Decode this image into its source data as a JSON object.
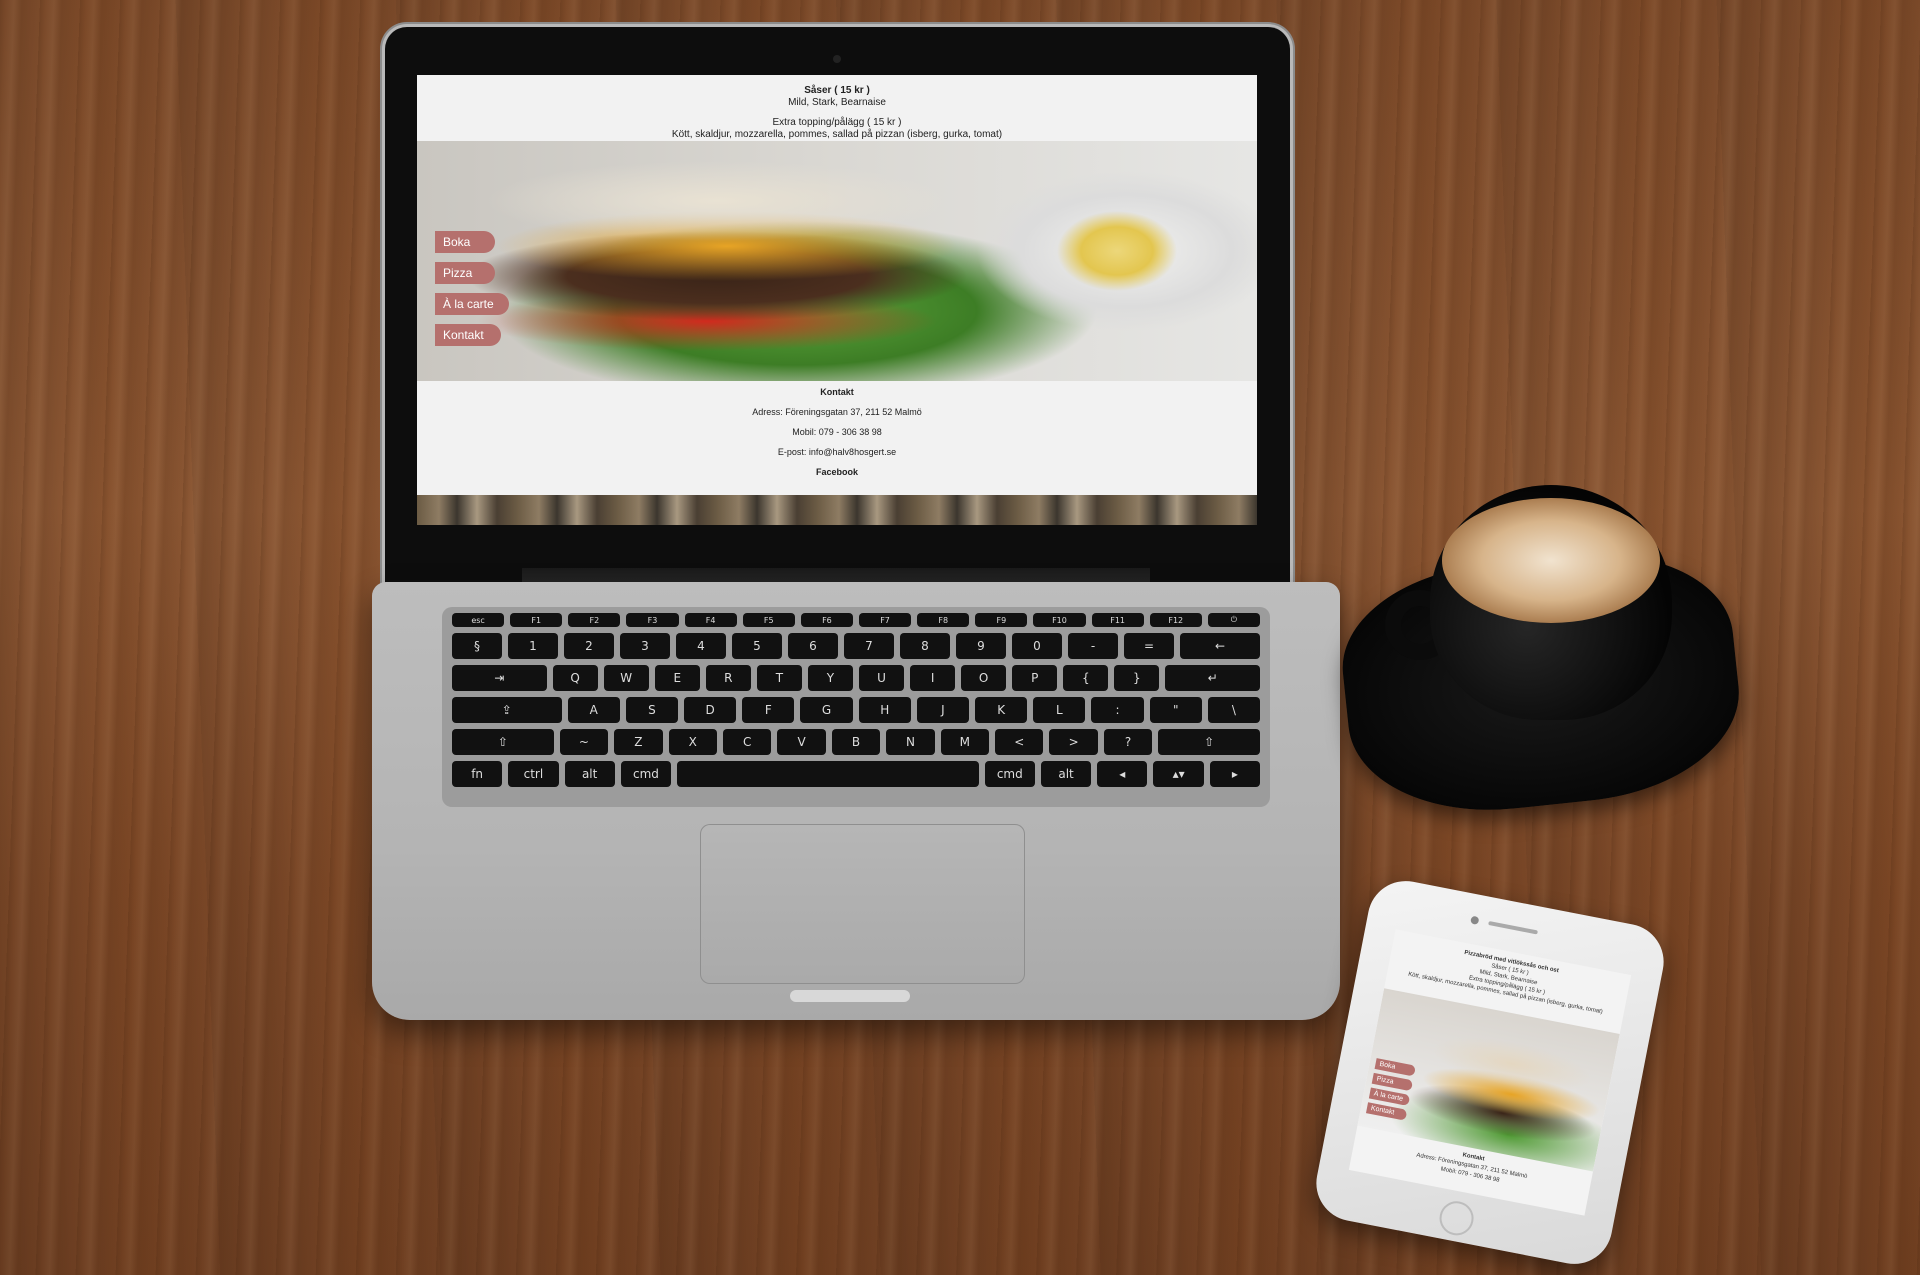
{
  "site": {
    "sauces_title": "Såser ( 15 kr )",
    "sauces_list": "Mild, Stark, Bearnaise",
    "extra_title": "Extra topping/pålägg ( 15 kr )",
    "extra_list": "Kött, skaldjur, mozzarella, pommes, sallad på pizzan (isberg, gurka, tomat)",
    "menu": [
      {
        "label": "Boka"
      },
      {
        "label": "Pizza"
      },
      {
        "label": "À la carte"
      },
      {
        "label": "Kontakt"
      }
    ],
    "contact": {
      "title": "Kontakt",
      "address": "Adress: Föreningsgatan 37, 211 52 Malmö",
      "phone": "Mobil: 079 - 306 38 98",
      "email": "E-post: info@halv8hosgert.se",
      "facebook": "Facebook"
    },
    "accent_color": "#b5706d"
  },
  "keyboard": {
    "row1": [
      "esc",
      "F1",
      "F2",
      "F3",
      "F4",
      "F5",
      "F6",
      "F7",
      "F8",
      "F9",
      "F10",
      "F11",
      "F12",
      "⏻"
    ],
    "row2": [
      "§",
      "1",
      "2",
      "3",
      "4",
      "5",
      "6",
      "7",
      "8",
      "9",
      "0",
      "-",
      "=",
      "←"
    ],
    "row3": [
      "⇥",
      "Q",
      "W",
      "E",
      "R",
      "T",
      "Y",
      "U",
      "I",
      "O",
      "P",
      "{",
      "}",
      "↵"
    ],
    "row4": [
      "⇪",
      "A",
      "S",
      "D",
      "F",
      "G",
      "H",
      "J",
      "K",
      "L",
      ":",
      "\"",
      "\\"
    ],
    "row5": [
      "⇧",
      "~",
      "Z",
      "X",
      "C",
      "V",
      "B",
      "N",
      "M",
      "<",
      ">",
      "?",
      "⇧"
    ],
    "row6": [
      "fn",
      "ctrl",
      "alt",
      "cmd",
      "",
      "cmd",
      "alt",
      "◂",
      "▴▾",
      "▸"
    ]
  },
  "phone": {
    "heading": "Pizzabröd med vitlökssås och ost",
    "sauces_title": "Såser ( 15 kr )",
    "sauces_list": "Mild, Stark, Bearnaise",
    "extra_title": "Extra topping/pålägg ( 15 kr )",
    "extra_list": "Kött, skaldjur, mozzarella, pommes, sallad på pizzan (isberg, gurka, tomat)",
    "menu": [
      "Boka",
      "Pizza",
      "À la carte",
      "Kontakt"
    ],
    "contact_title": "Kontakt",
    "address": "Adress: Föreningsgatan 37, 211 52 Malmö",
    "phone": "Mobil: 079 - 306 38 98"
  }
}
